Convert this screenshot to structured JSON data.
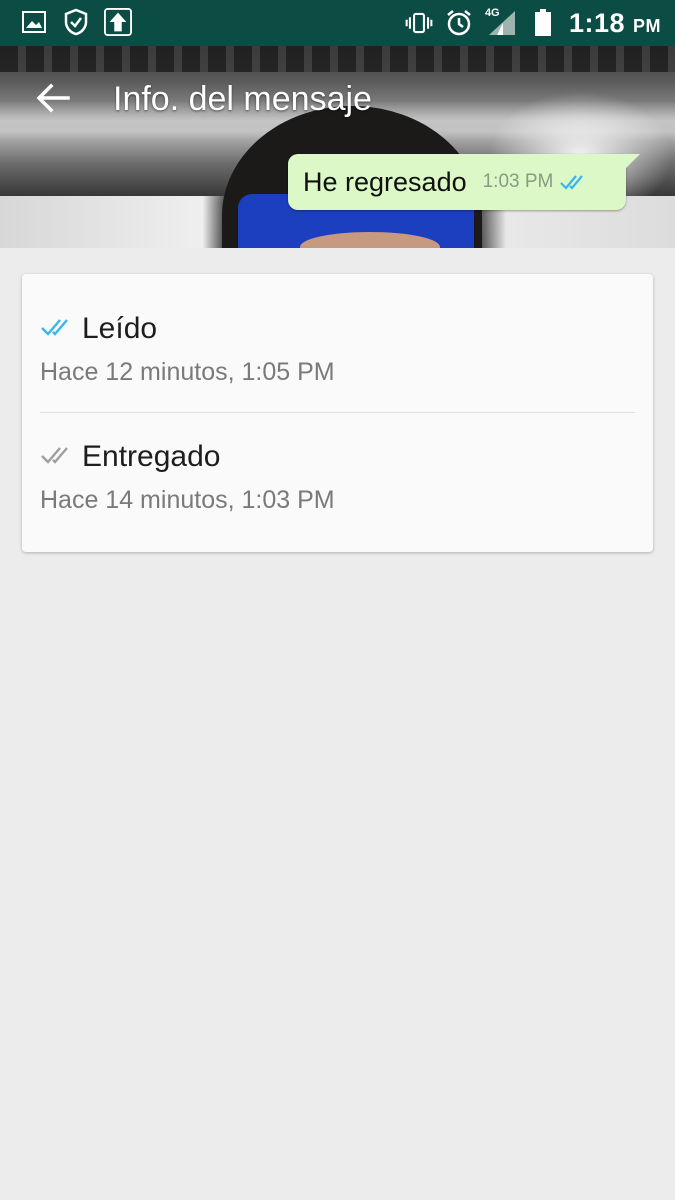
{
  "status_bar": {
    "left_icons": [
      "image-icon",
      "shield-check-icon",
      "upload-icon"
    ],
    "right_icons": [
      "vibrate-icon",
      "alarm-icon",
      "signal-icon",
      "battery-icon"
    ],
    "network": "4G",
    "time": "1:18",
    "ampm": "PM"
  },
  "header": {
    "title": "Info. del mensaje",
    "back_icon": "arrow-back-icon"
  },
  "message": {
    "text": "He regresado",
    "time": "1:03 PM",
    "ticks_color": "#34b7f1"
  },
  "receipts": [
    {
      "label": "Leído",
      "time": "Hace 12 minutos, 1:05 PM",
      "ticks_color": "#34b7f1"
    },
    {
      "label": "Entregado",
      "time": "Hace 14 minutos, 1:03 PM",
      "ticks_color": "#9e9e9e"
    }
  ],
  "colors": {
    "status_bar_bg": "#0b4d44",
    "bubble_bg": "#dcf8c6",
    "page_bg": "#ececec",
    "read_blue": "#34b7f1"
  }
}
